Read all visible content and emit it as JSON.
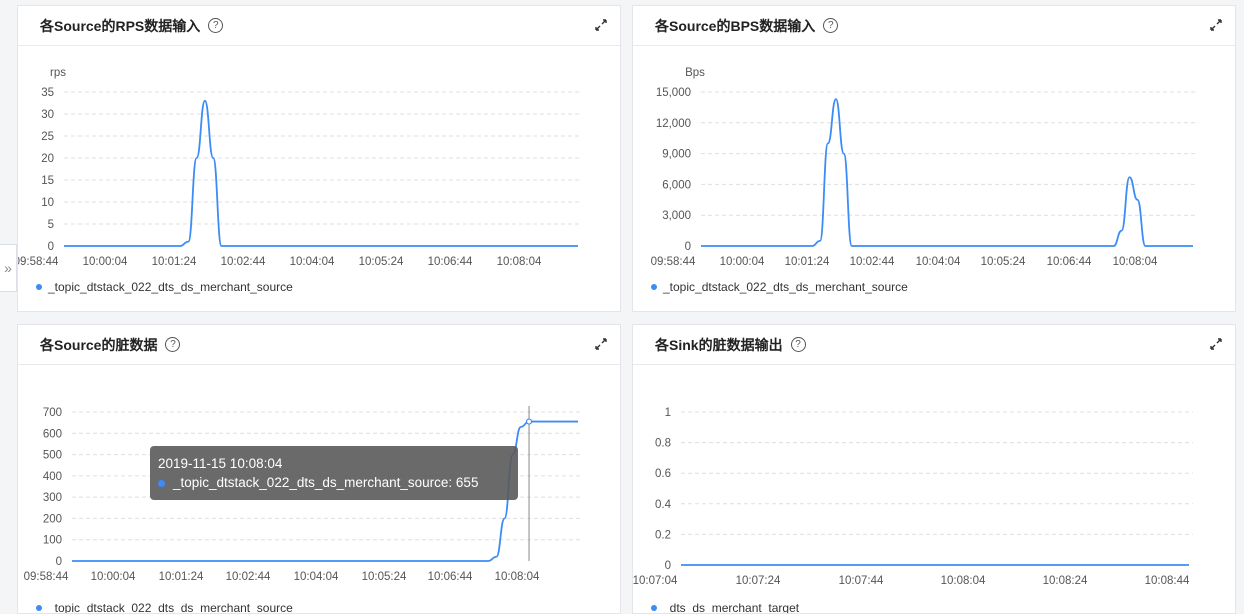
{
  "accent_color": "#3b8cf6",
  "sidebar_toggle": {
    "icon": "double-chevron-right-icon",
    "glyph": "»"
  },
  "panels": [
    {
      "title": "各Source的RPS数据输入",
      "help_glyph": "?",
      "legend": "_topic_dtstack_022_dts_ds_merchant_source",
      "chart_data": {
        "type": "line",
        "ylabel": "rps",
        "y_ticks": [
          "35",
          "30",
          "25",
          "20",
          "15",
          "10",
          "5",
          "0"
        ],
        "ylim": [
          0,
          35
        ],
        "x_ticks": [
          "09:58:44",
          "10:00:04",
          "10:01:24",
          "10:02:44",
          "10:04:04",
          "10:05:24",
          "10:06:44",
          "10:08:04"
        ],
        "series": [
          {
            "name": "_topic_dtstack_022_dts_ds_merchant_source",
            "points": [
              [
                "09:58:44",
                0
              ],
              [
                "10:01:04",
                0
              ],
              [
                "10:01:14",
                1
              ],
              [
                "10:01:24",
                20
              ],
              [
                "10:01:34",
                33
              ],
              [
                "10:01:44",
                20
              ],
              [
                "10:01:54",
                0
              ],
              [
                "10:09:04",
                0
              ]
            ]
          }
        ]
      }
    },
    {
      "title": "各Source的BPS数据输入",
      "help_glyph": "?",
      "legend": "_topic_dtstack_022_dts_ds_merchant_source",
      "chart_data": {
        "type": "line",
        "ylabel": "Bps",
        "y_ticks": [
          "15,000",
          "12,000",
          "9,000",
          "6,000",
          "3,000",
          "0"
        ],
        "ylim": [
          0,
          15000
        ],
        "x_ticks": [
          "09:58:44",
          "10:00:04",
          "10:01:24",
          "10:02:44",
          "10:04:04",
          "10:05:24",
          "10:06:44",
          "10:08:04"
        ],
        "series": [
          {
            "name": "_topic_dtstack_022_dts_ds_merchant_source",
            "points": [
              [
                "09:58:44",
                0
              ],
              [
                "10:01:04",
                0
              ],
              [
                "10:01:14",
                500
              ],
              [
                "10:01:24",
                10000
              ],
              [
                "10:01:34",
                14300
              ],
              [
                "10:01:44",
                9000
              ],
              [
                "10:01:54",
                0
              ],
              [
                "10:07:24",
                0
              ],
              [
                "10:07:34",
                1500
              ],
              [
                "10:07:44",
                6700
              ],
              [
                "10:07:54",
                4500
              ],
              [
                "10:08:04",
                0
              ],
              [
                "10:09:04",
                0
              ]
            ]
          }
        ]
      }
    },
    {
      "title": "各Source的脏数据",
      "help_glyph": "?",
      "legend": "_topic_dtstack_022_dts_ds_merchant_source",
      "tooltip": {
        "time": "2019-11-15 10:08:04",
        "series": "_topic_dtstack_022_dts_ds_merchant_source: 655"
      },
      "chart_data": {
        "type": "line",
        "ylabel": "",
        "y_ticks": [
          "700",
          "600",
          "500",
          "400",
          "300",
          "200",
          "100",
          "0"
        ],
        "ylim": [
          0,
          700
        ],
        "x_ticks": [
          "09:58:44",
          "10:00:04",
          "10:01:24",
          "10:02:44",
          "10:04:04",
          "10:05:24",
          "10:06:44",
          "10:08:04"
        ],
        "series": [
          {
            "name": "_topic_dtstack_022_dts_ds_merchant_source",
            "points": [
              [
                "09:58:44",
                0
              ],
              [
                "10:07:14",
                0
              ],
              [
                "10:07:24",
                20
              ],
              [
                "10:07:34",
                200
              ],
              [
                "10:07:44",
                500
              ],
              [
                "10:07:54",
                630
              ],
              [
                "10:08:04",
                655
              ],
              [
                "10:09:04",
                655
              ]
            ]
          }
        ]
      }
    },
    {
      "title": "各Sink的脏数据输出",
      "help_glyph": "?",
      "legend": "_dts_ds_merchant_target",
      "chart_data": {
        "type": "line",
        "ylabel": "",
        "y_ticks": [
          "1",
          "0.8",
          "0.6",
          "0.4",
          "0.2",
          "0"
        ],
        "ylim": [
          0,
          1
        ],
        "x_ticks": [
          "10:07:04",
          "10:07:24",
          "10:07:44",
          "10:08:04",
          "10:08:24",
          "10:08:44"
        ],
        "series": [
          {
            "name": "_dts_ds_merchant_target",
            "points": [
              [
                "10:07:04",
                0
              ],
              [
                "10:08:44",
                0
              ]
            ]
          }
        ]
      }
    }
  ]
}
